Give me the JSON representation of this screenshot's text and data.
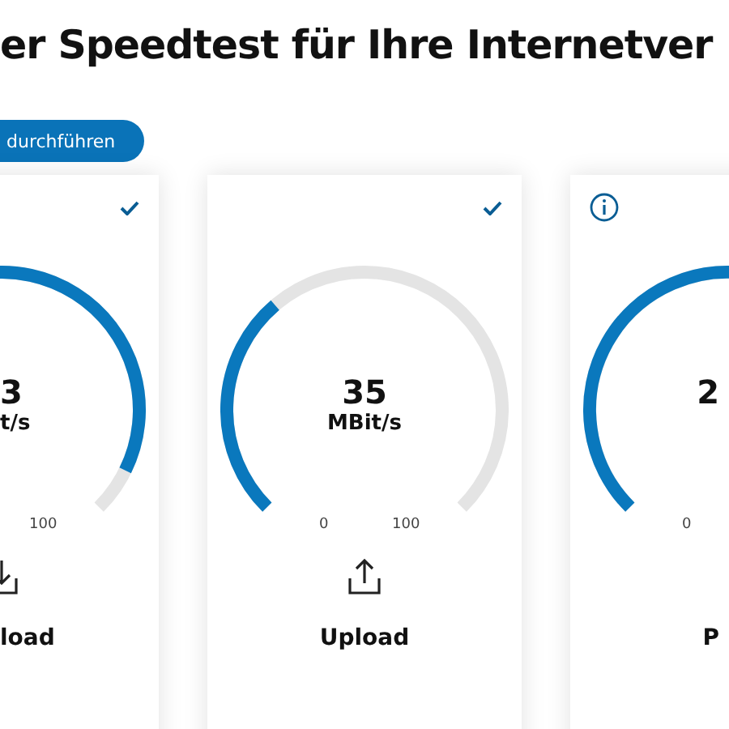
{
  "title": "er Speedtest für Ihre Internetver",
  "start_button": {
    "label": "durchführen"
  },
  "cards": [
    {
      "badge": {
        "kind": "check"
      },
      "value": "3",
      "unit": "t/s",
      "max_label": "100",
      "icon": {
        "kind": "download"
      },
      "label": "load"
    },
    {
      "badge": {
        "kind": "check"
      },
      "value": "35",
      "unit": "MBit/s",
      "min_label": "0",
      "max_label": "100",
      "icon": {
        "kind": "upload"
      },
      "label": "Upload"
    },
    {
      "badge": {
        "kind": "info"
      },
      "value": "2",
      "min_label": "0",
      "label": "P"
    }
  ]
}
